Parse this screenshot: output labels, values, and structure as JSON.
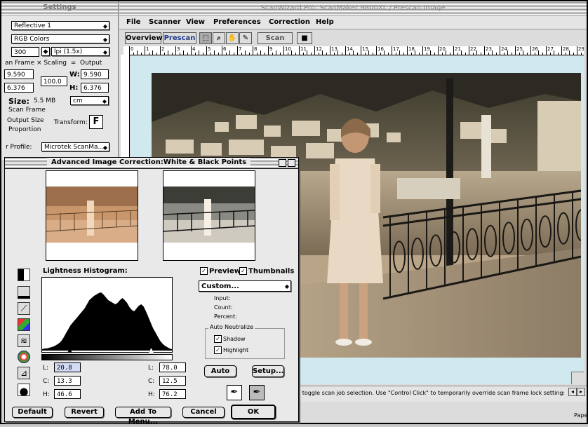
{
  "settings": {
    "title": "Settings",
    "source": "Reflective 1",
    "mode": "RGB Colors",
    "resolution": "300",
    "resolution_unit": "lpi (1.5x)",
    "scan_frame_label": "an Frame",
    "x_label": "×",
    "scaling_label": "Scaling",
    "eq_label": "=",
    "output_label": "Output",
    "in_w": "9.590",
    "in_h": "6.376",
    "scaling_value": "100.0",
    "w_label": "W:",
    "h_label": "H:",
    "out_w": "9.590",
    "out_h": "6.376",
    "size_label": "Size:",
    "size_value": "5.5 MB",
    "unit": "cm",
    "opt_scan_frame": "Scan Frame",
    "opt_output_size": "Output Size",
    "transform_label": "Transform:",
    "transform_btn": "F",
    "opt_proportion": "Proportion",
    "profile_label": "r Profile:",
    "profile_value": "Microtek ScanMa..."
  },
  "main_window": {
    "title": "ScanWizard Pro: ScanMaker 9800XL / Prescan Image",
    "menu": [
      "File",
      "Scanner",
      "View",
      "Preferences",
      "Correction",
      "Help"
    ],
    "overview_btn": "Overview",
    "prescan_btn": "Prescan",
    "scan_btn": "Scan",
    "ruler_ticks": [
      "0",
      "1",
      "2",
      "3",
      "4",
      "5",
      "6",
      "7",
      "8",
      "9",
      "10",
      "11",
      "12",
      "13",
      "14",
      "15",
      "16",
      "17",
      "18",
      "19",
      "20",
      "21",
      "22",
      "23",
      "24",
      "25",
      "26",
      "27",
      "28",
      "29"
    ],
    "status_text": "s toggle scan job selection. Use \"Control Click\" to temporarily override scan frame lock settings.",
    "corner_text": "Pape"
  },
  "dialog": {
    "title": "Advanced Image Correction:White & Black Points",
    "histogram_label": "Lightness Histogram:",
    "preview_label": "Preview",
    "thumbnails_label": "Thumbnails",
    "preset": "Custom...",
    "input_label": "Input:",
    "count_label": "Count:",
    "percent_label": "Percent:",
    "auto_neutralize": "Auto Neutralize",
    "shadow_label": "Shadow",
    "highlight_label": "Highlight",
    "auto_btn": "Auto",
    "setup_btn": "Setup...",
    "left_values": {
      "L_label": "L:",
      "L": "20.8",
      "C_label": "C:",
      "C": "13.3",
      "H_label": "H:",
      "H": "46.6"
    },
    "right_values": {
      "L_label": "L:",
      "L": "78.0",
      "C_label": "C:",
      "C": "12.5",
      "H_label": "H:",
      "H": "76.2"
    },
    "buttons": {
      "default": "Default",
      "revert": "Revert",
      "add_to_menu": "Add To Menu...",
      "cancel": "Cancel",
      "ok": "OK"
    },
    "check_mark": "✓"
  },
  "histogram_data": [
    2,
    3,
    3,
    4,
    5,
    6,
    8,
    10,
    13,
    18,
    24,
    30,
    36,
    40,
    44,
    48,
    52,
    56,
    60,
    66,
    72,
    75,
    78,
    80,
    82,
    83,
    80,
    76,
    72,
    70,
    68,
    66,
    68,
    72,
    75,
    72,
    68,
    62,
    58,
    56,
    60,
    64,
    66,
    63,
    56,
    48,
    40,
    32,
    26,
    20,
    14,
    10,
    7,
    5,
    3,
    2
  ]
}
